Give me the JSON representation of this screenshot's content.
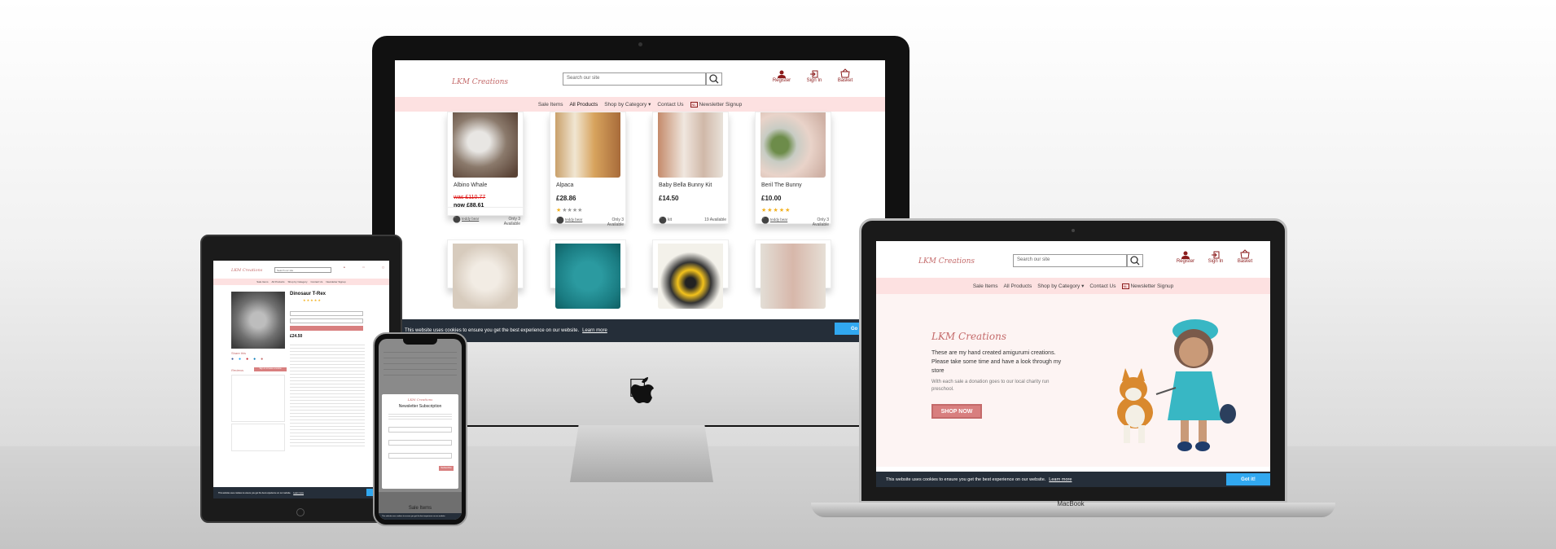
{
  "site": {
    "logo": "LKM Creations",
    "search_placeholder": "Search our site",
    "nav": [
      "Sale Items",
      "All Products",
      "Shop by Category",
      "Contact Us",
      "Newsletter Signup"
    ],
    "actions": [
      "Register",
      "Sign In",
      "Basket"
    ],
    "cookie_text": "This website uses cookies to ensure you get the best experience on our website.",
    "cookie_link": "Learn more",
    "cookie_button": "Got it!"
  },
  "desktop": {
    "products": [
      {
        "name": "Albino Whale",
        "price_was": "was £110.77",
        "price_now": "now £88.61",
        "tag": "teddy bear",
        "stock": "Only 3 Available"
      },
      {
        "name": "Alpaca",
        "price": "£28.86",
        "rating": 1,
        "tag": "teddy bear",
        "stock": "Only 3 Available"
      },
      {
        "name": "Baby Bella Bunny Kit",
        "price": "£14.50",
        "tag": "kit",
        "stock": "19 Available"
      },
      {
        "name": "Beril The Bunny",
        "price": "£10.00",
        "rating": 5,
        "tag": "teddy bear",
        "stock": "Only 3 Available"
      }
    ],
    "partial_button": "Go"
  },
  "laptop": {
    "hero_title": "LKM Creations",
    "hero_text": "These are my hand created amigurumi creations. Please take some time and have a look through my store",
    "hero_sub": "With each sale a donation goes to our local charity run preschool.",
    "cta": "SHOP NOW",
    "brand": "MacBook"
  },
  "tablet": {
    "product_title": "Dinosaur T-Rex",
    "price": "£24.50",
    "share": "Share this",
    "reviews": "Reviews",
    "add_review": "Sign in to leave a review"
  },
  "phone": {
    "logo": "LKM Creations",
    "modal_title": "Newsletter Subscription",
    "subscribe": "Subscribe",
    "footer_item": "Sale Items"
  },
  "colors": {
    "accent": "#c46a6a",
    "nav_bg": "#fde1e1",
    "cookie_bg": "#252e39",
    "cookie_btn": "#31a8f0",
    "star": "#f2b01e"
  }
}
